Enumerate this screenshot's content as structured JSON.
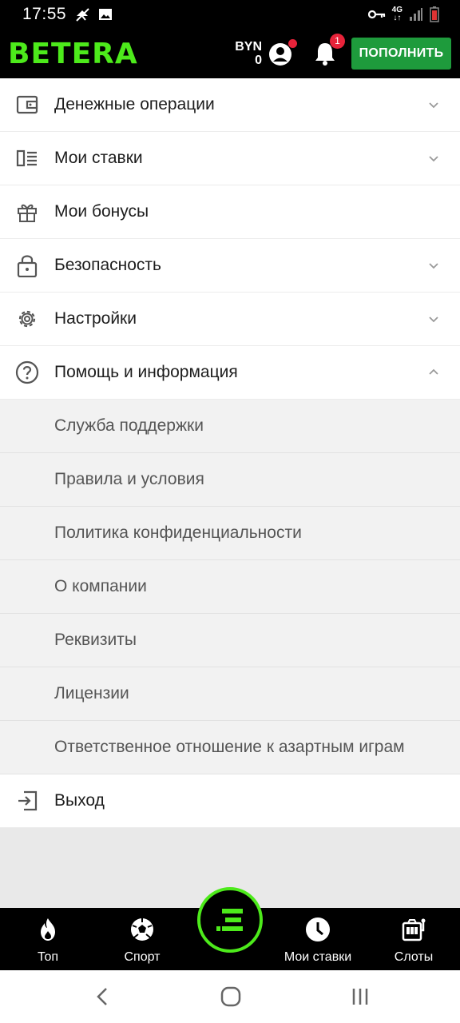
{
  "status_bar": {
    "time": "17:55",
    "network": "4G"
  },
  "header": {
    "logo": "BETERA",
    "currency": "BYN",
    "balance": "0",
    "notification_count": "1",
    "topup_label": "ПОПОЛНИТЬ"
  },
  "menu": {
    "items": [
      {
        "label": "Денежные операции",
        "icon": "wallet-icon",
        "expanded": false
      },
      {
        "label": "Мои ставки",
        "icon": "bets-list-icon",
        "expanded": false
      },
      {
        "label": "Мои бонусы",
        "icon": "gift-icon"
      },
      {
        "label": "Безопасность",
        "icon": "lock-icon",
        "expanded": false
      },
      {
        "label": "Настройки",
        "icon": "gear-icon",
        "expanded": false
      },
      {
        "label": "Помощь и информация",
        "icon": "help-icon",
        "expanded": true
      }
    ],
    "help_subitems": [
      "Служба поддержки",
      "Правила и условия",
      "Политика конфиденциальности",
      "О компании",
      "Реквизиты",
      "Лицензии",
      "Ответственное отношение к азартным играм"
    ],
    "logout": {
      "label": "Выход",
      "icon": "logout-icon"
    }
  },
  "bottom_nav": {
    "items": [
      {
        "label": "Топ",
        "icon": "flame-icon"
      },
      {
        "label": "Спорт",
        "icon": "soccer-ball-icon"
      },
      {
        "label": "Мои ставки",
        "icon": "clock-icon"
      },
      {
        "label": "Слоты",
        "icon": "slot-machine-icon"
      }
    ],
    "center_icon": "betera-e-icon"
  },
  "colors": {
    "brand_green": "#4dea1b",
    "button_green": "#1e9b3c",
    "badge_red": "#e8233a"
  }
}
